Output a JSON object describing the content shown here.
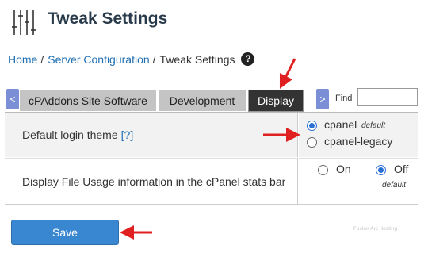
{
  "header": {
    "title": "Tweak Settings",
    "logo_icon": "sliders-icon"
  },
  "breadcrumb": {
    "items": [
      "Home",
      "Server Configuration",
      "Tweak Settings"
    ],
    "separator": "/",
    "help_icon_glyph": "?"
  },
  "tabs": {
    "scroll_left": "<",
    "scroll_right": ">",
    "items": [
      "cPAddons Site Software",
      "Development",
      "Display"
    ],
    "active": "Display",
    "find_label": "Find",
    "find_value": ""
  },
  "settings": [
    {
      "label": "Default login theme",
      "help_link": "[?]",
      "options": [
        {
          "label": "cpanel",
          "note": "default",
          "selected": true
        },
        {
          "label": "cpanel-legacy",
          "note": "",
          "selected": false
        }
      ]
    },
    {
      "label": "Display File Usage information in the cPanel stats bar",
      "options": [
        {
          "label": "On",
          "note": "",
          "selected": false
        },
        {
          "label": "Off",
          "note": "default",
          "selected": true
        }
      ]
    }
  ],
  "save_label": "Save",
  "watermark": "Fusion Arc Hosting",
  "colors": {
    "link": "#1f6fb2",
    "active_tab": "#333333",
    "save_button": "#3a87d1",
    "annotation_arrow": "#e02020"
  }
}
